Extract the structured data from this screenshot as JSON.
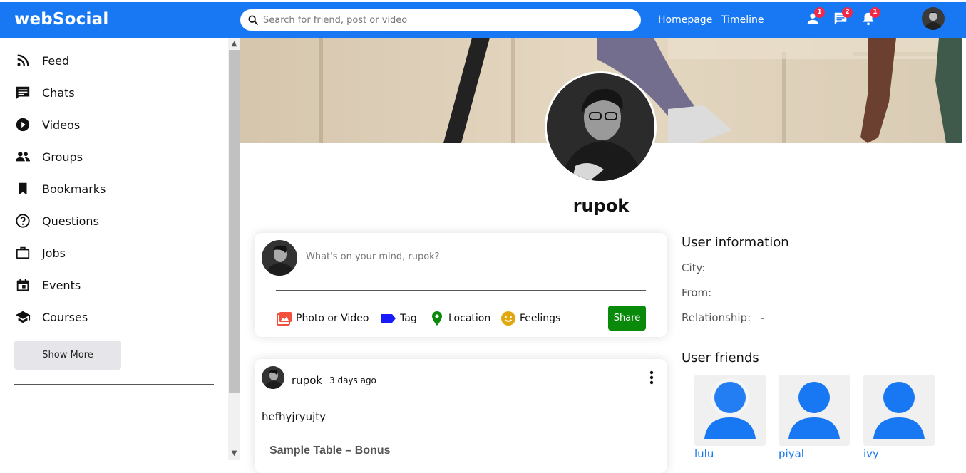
{
  "app": {
    "logo": "webSocial"
  },
  "search": {
    "placeholder": "Search for friend, post or video"
  },
  "topnav": {
    "links": [
      "Homepage",
      "Timeline"
    ],
    "icons": [
      {
        "icon": "person-icon",
        "badge": "1"
      },
      {
        "icon": "chat-icon",
        "badge": "2"
      },
      {
        "icon": "bell-icon",
        "badge": "1"
      }
    ]
  },
  "sidebar": {
    "items": [
      {
        "label": "Feed",
        "icon": "rss-feed-icon"
      },
      {
        "label": "Chats",
        "icon": "chat-icon"
      },
      {
        "label": "Videos",
        "icon": "play-circle-icon"
      },
      {
        "label": "Groups",
        "icon": "group-icon"
      },
      {
        "label": "Bookmarks",
        "icon": "bookmark-icon"
      },
      {
        "label": "Questions",
        "icon": "help-circle-icon"
      },
      {
        "label": "Jobs",
        "icon": "briefcase-icon"
      },
      {
        "label": "Events",
        "icon": "calendar-icon"
      },
      {
        "label": "Courses",
        "icon": "school-icon"
      }
    ],
    "show_more": "Show More"
  },
  "profile": {
    "name": "rupok"
  },
  "share": {
    "placeholder": "What's on your mind, rupok?",
    "options": [
      {
        "label": "Photo or Video",
        "icon": "photo-icon",
        "color": "#f3503c"
      },
      {
        "label": "Tag",
        "icon": "label-icon",
        "color": "#1a1aff"
      },
      {
        "label": "Location",
        "icon": "location-pin-icon",
        "color": "#0a8a0a"
      },
      {
        "label": "Feelings",
        "icon": "emoji-icon",
        "color": "#e2a70f"
      }
    ],
    "button": "Share"
  },
  "post": {
    "user": "rupok",
    "time": "3 days ago",
    "text": "hefhyjryujty",
    "image_title": "Sample Table – Bonus"
  },
  "user_info": {
    "title": "User information",
    "rows": [
      {
        "label": "City:",
        "value": ""
      },
      {
        "label": "From:",
        "value": ""
      },
      {
        "label": "Relationship:",
        "value": "-"
      }
    ]
  },
  "friends": {
    "title": "User friends",
    "list": [
      "lulu",
      "piyal",
      "ivy"
    ]
  },
  "colors": {
    "brand": "#1877f2",
    "share_button": "#0a8a0a",
    "badge": "#f02849"
  }
}
